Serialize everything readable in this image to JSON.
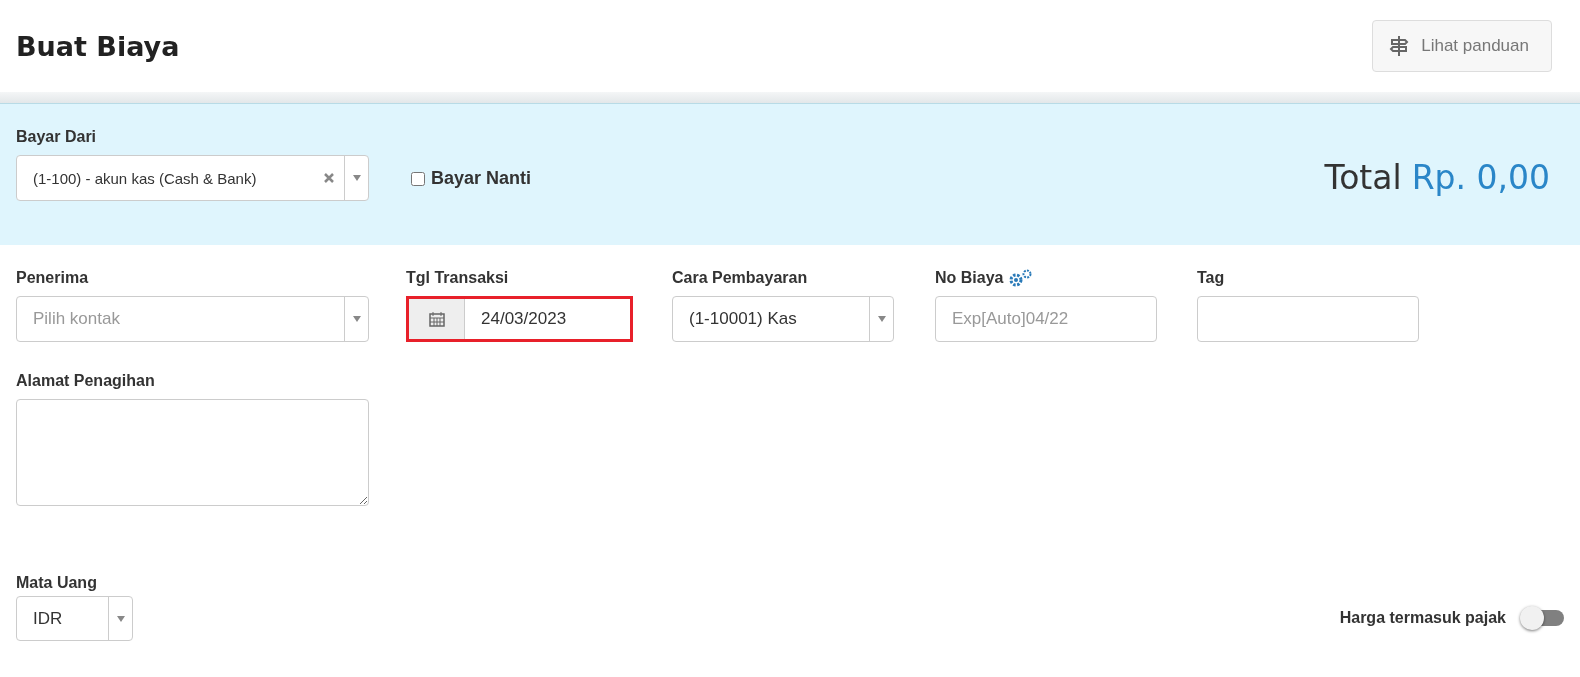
{
  "header": {
    "title": "Buat Biaya",
    "guide_button": "Lihat panduan"
  },
  "payment_panel": {
    "pay_from": {
      "label": "Bayar Dari",
      "value": "(1-100) - akun kas (Cash & Bank)"
    },
    "pay_later": {
      "label": "Bayar Nanti",
      "checked": false
    },
    "total_label": "Total",
    "total_value": "Rp. 0,00"
  },
  "fields": [
    {
      "kind": "select",
      "label": "Penerima",
      "placeholder": "Pilih kontak"
    },
    {
      "kind": "date",
      "label": "Tgl Transaksi",
      "value": "24/03/2023",
      "highlighted": true
    },
    {
      "kind": "select",
      "label": "Cara Pembayaran",
      "value": "(1-10001) Kas"
    },
    {
      "kind": "text",
      "label": "No Biaya",
      "placeholder": "Exp[Auto]04/22",
      "settings": true
    },
    {
      "kind": "text",
      "label": "Tag"
    }
  ],
  "billing_address": {
    "label": "Alamat Penagihan"
  },
  "currency": {
    "label": "Mata Uang",
    "value": "IDR"
  },
  "tax_inclusive": {
    "label": "Harga termasuk pajak",
    "on": false
  }
}
